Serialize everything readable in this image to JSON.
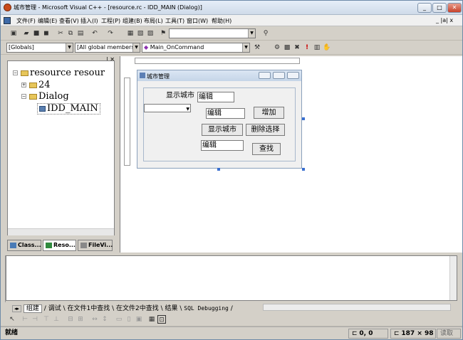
{
  "window": {
    "title": "城市管理 - Microsoft Visual C++ - [resource.rc - IDD_MAIN (Dialog)]",
    "minimize": "_",
    "maximize": "□",
    "close": "✕"
  },
  "menubar": {
    "items": [
      "文件(F)",
      "编辑(E)",
      "查看(V)",
      "插入(I)",
      "工程(P)",
      "组建(B)",
      "布局(L)",
      "工具(T)",
      "窗口(W)",
      "帮助(H)"
    ],
    "right_controls": "_ |a| x"
  },
  "toolbar2": {
    "globals_combo": "[Globals]",
    "members_combo": "[All global members",
    "function_combo": "Main_OnCommand"
  },
  "tree": {
    "root": "resource resour",
    "node_24": "24",
    "node_dialog": "Dialog",
    "node_main": "IDD_MAIN"
  },
  "left_tabs": [
    "Class...",
    "Reso...",
    "FileVi..."
  ],
  "dialog": {
    "title": "城市管理",
    "label_show_city": "显示城市",
    "edit1": "编辑",
    "edit2": "编辑",
    "edit3": "编辑",
    "btn_add": "增加",
    "btn_show_city": "显示城市",
    "btn_delete": "删除选择",
    "btn_find": "查找"
  },
  "output_tabs": [
    "组建",
    "调试",
    "在文件1中查找",
    "在文件2中查找",
    "结果",
    "SQL Debugging"
  ],
  "status": {
    "left": "就绪",
    "pos": "0, 0",
    "size": "187 × 98",
    "read": "读取"
  }
}
